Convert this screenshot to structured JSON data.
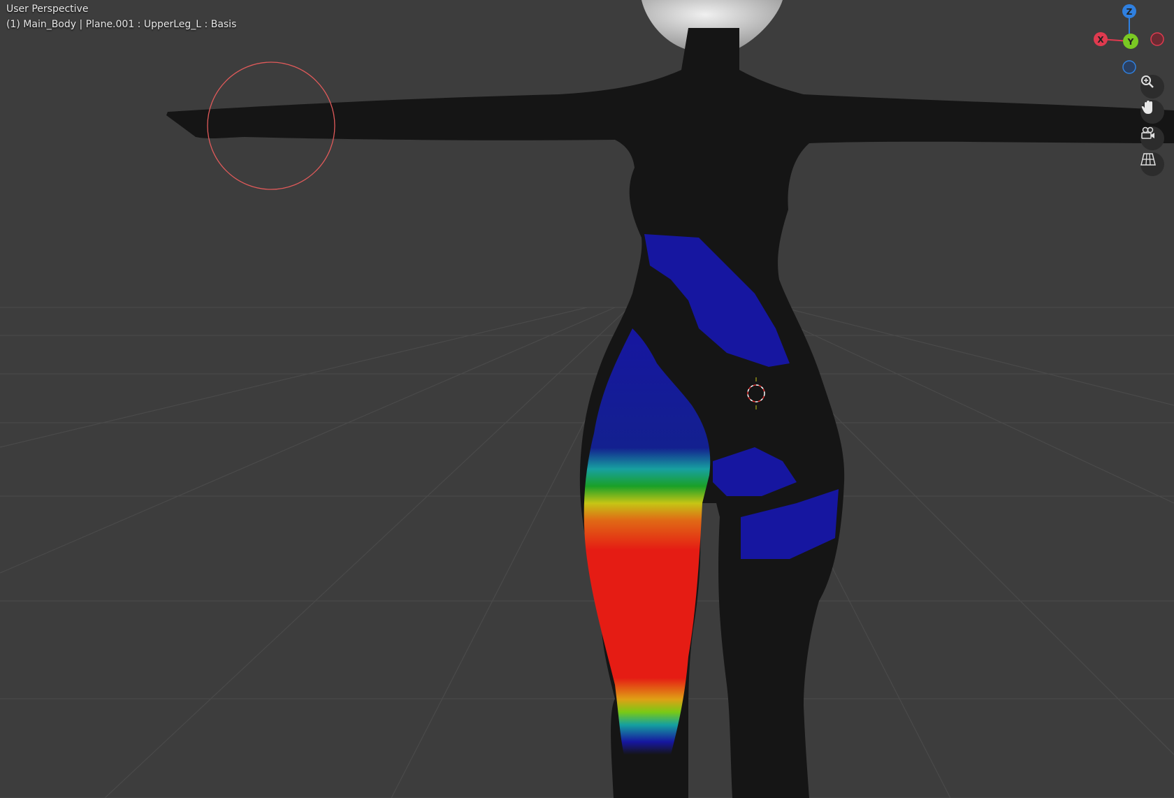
{
  "overlay": {
    "view_name": "User Perspective",
    "object_info": "(1) Main_Body | Plane.001 : UpperLeg_L : Basis"
  },
  "gizmo": {
    "axes": [
      {
        "label": "Z",
        "color": "#2f80e0"
      },
      {
        "label": "Y",
        "color": "#7ac923"
      },
      {
        "label": "X",
        "color": "#e03a4f"
      }
    ]
  },
  "nav_buttons": [
    {
      "name": "zoom-icon"
    },
    {
      "name": "pan-hand-icon"
    },
    {
      "name": "camera-icon"
    },
    {
      "name": "perspective-grid-icon"
    }
  ],
  "colors": {
    "background": "#3d3d3d",
    "grid": "#4a4a4a",
    "mesh": "#151515",
    "brush_circle": "#e05a5a",
    "weight_low": "#1616a0",
    "weight_high": "#e51c14"
  }
}
